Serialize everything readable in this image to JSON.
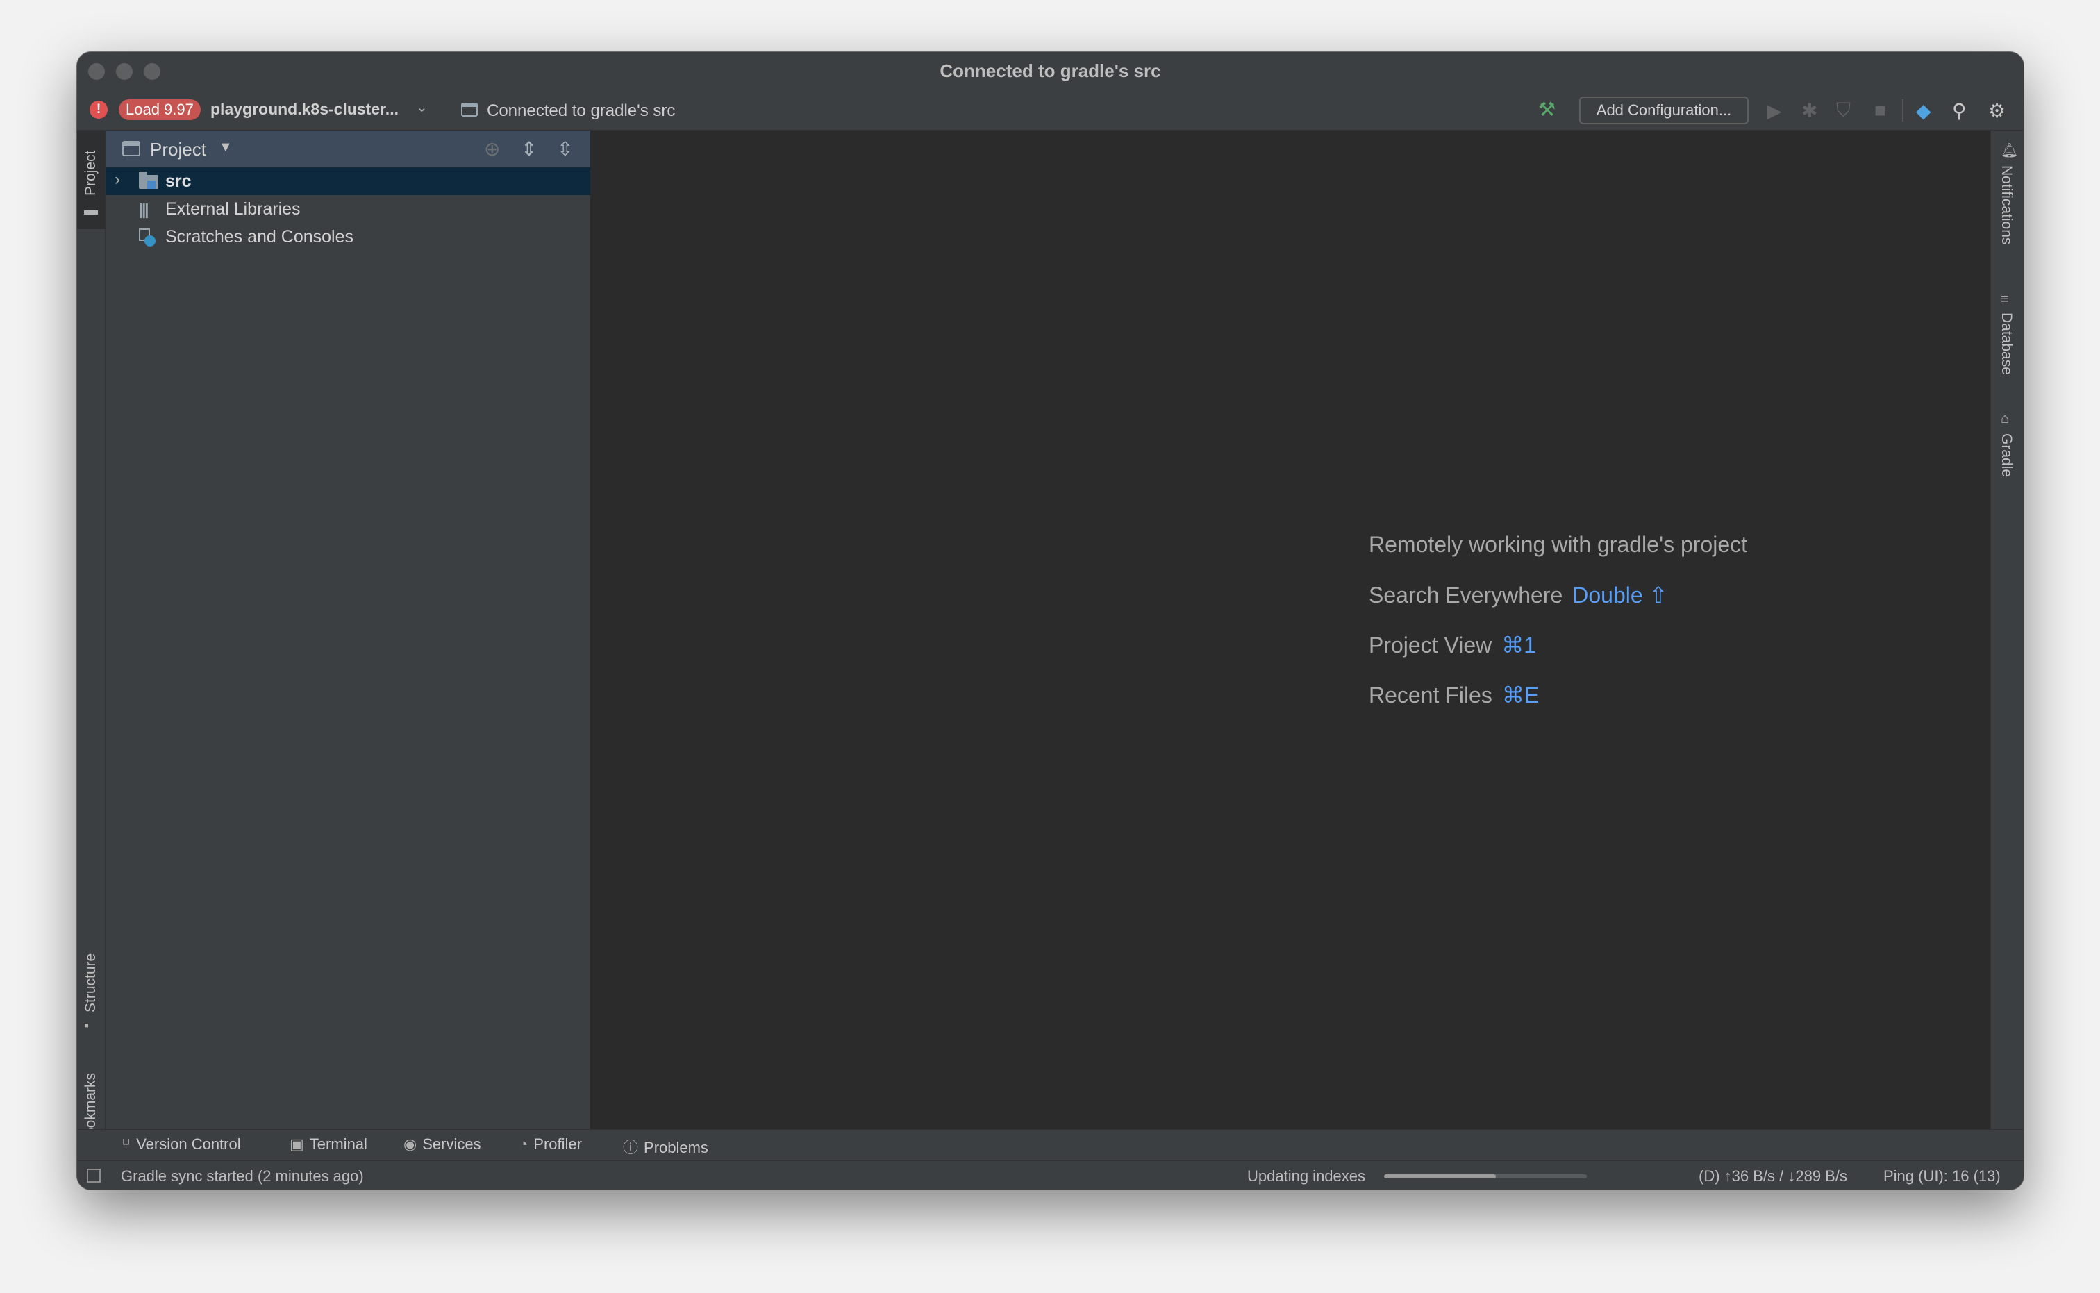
{
  "window": {
    "title": "Connected to gradle's src"
  },
  "toolbar": {
    "load_badge": "Load 9.97",
    "project_selector": "playground.k8s-cluster...",
    "connection_label": "Connected to gradle's src",
    "add_configuration": "Add Configuration..."
  },
  "left_stripe": {
    "project": "Project",
    "structure": "Structure",
    "bookmarks": "Bookmarks"
  },
  "right_stripe": {
    "notifications": "Notifications",
    "database": "Database",
    "gradle": "Gradle"
  },
  "project_panel": {
    "title": "Project",
    "tree": [
      {
        "label": "src",
        "icon": "folder-icon",
        "selected": true,
        "expandable": true
      },
      {
        "label": "External Libraries",
        "icon": "library-icon"
      },
      {
        "label": "Scratches and Consoles",
        "icon": "scratches-icon"
      }
    ]
  },
  "editor": {
    "headline": "Remotely working with gradle's project",
    "hints": [
      {
        "label": "Search Everywhere",
        "shortcut": "Double ⇧"
      },
      {
        "label": "Project View",
        "shortcut": "⌘1"
      },
      {
        "label": "Recent Files",
        "shortcut": "⌘E"
      }
    ]
  },
  "bottom_tools": [
    "Version Control",
    "Terminal",
    "Services",
    "Profiler",
    "Problems"
  ],
  "status": {
    "message": "Gradle sync started (2 minutes ago)",
    "task": "Updating indexes",
    "progress": 0.55,
    "network": "(D) ↑36 B/s / ↓289 B/s",
    "ping": "Ping (UI): 16 (13)"
  },
  "colors": {
    "accent": "#589df6",
    "badge": "#c75450",
    "selection": "#0d293e",
    "build": "#59a869"
  }
}
